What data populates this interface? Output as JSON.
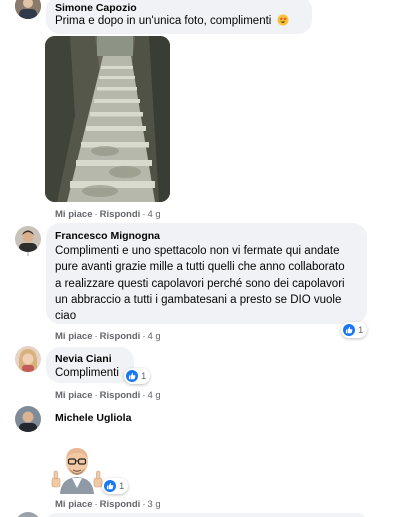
{
  "comments": [
    {
      "author": "Simone Capozio",
      "text": "Prima e dopo in un'unica foto, complimenti",
      "text_emoji": "star-struck-emoji",
      "like_label": "Mi piace",
      "reply_label": "Rispondi",
      "age": "4 g",
      "photo": "stone-staircase-photo"
    },
    {
      "author": "Francesco Mignogna",
      "lines": [
        "Complimenti e uno spettacolo non vi fermate qui andate",
        "pure avanti grazie mille a tutti quelli che anno collaborato",
        "a realizzare questi capolavori perché sono dei capolavori",
        "un abbraccio a tutti i gambatesani a presto se DIO vuole",
        "ciao"
      ],
      "like_label": "Mi piace",
      "reply_label": "Rispondi",
      "age": "4 g",
      "reaction_count": "1"
    },
    {
      "author": "Nevia Ciani",
      "text": "Complimenti",
      "like_label": "Mi piace",
      "reply_label": "Rispondi",
      "age": "4 g",
      "reaction_count": "1"
    },
    {
      "author": "Michele Ugliola",
      "sticker": "thumbs-up-avatar-sticker",
      "like_label": "Mi piace",
      "reply_label": "Rispondi",
      "age": "3 g",
      "reaction_count": "1"
    }
  ],
  "colors": {
    "bubble": "#f0f2f5",
    "meta": "#65676b",
    "like_blue": "#1877f2"
  }
}
